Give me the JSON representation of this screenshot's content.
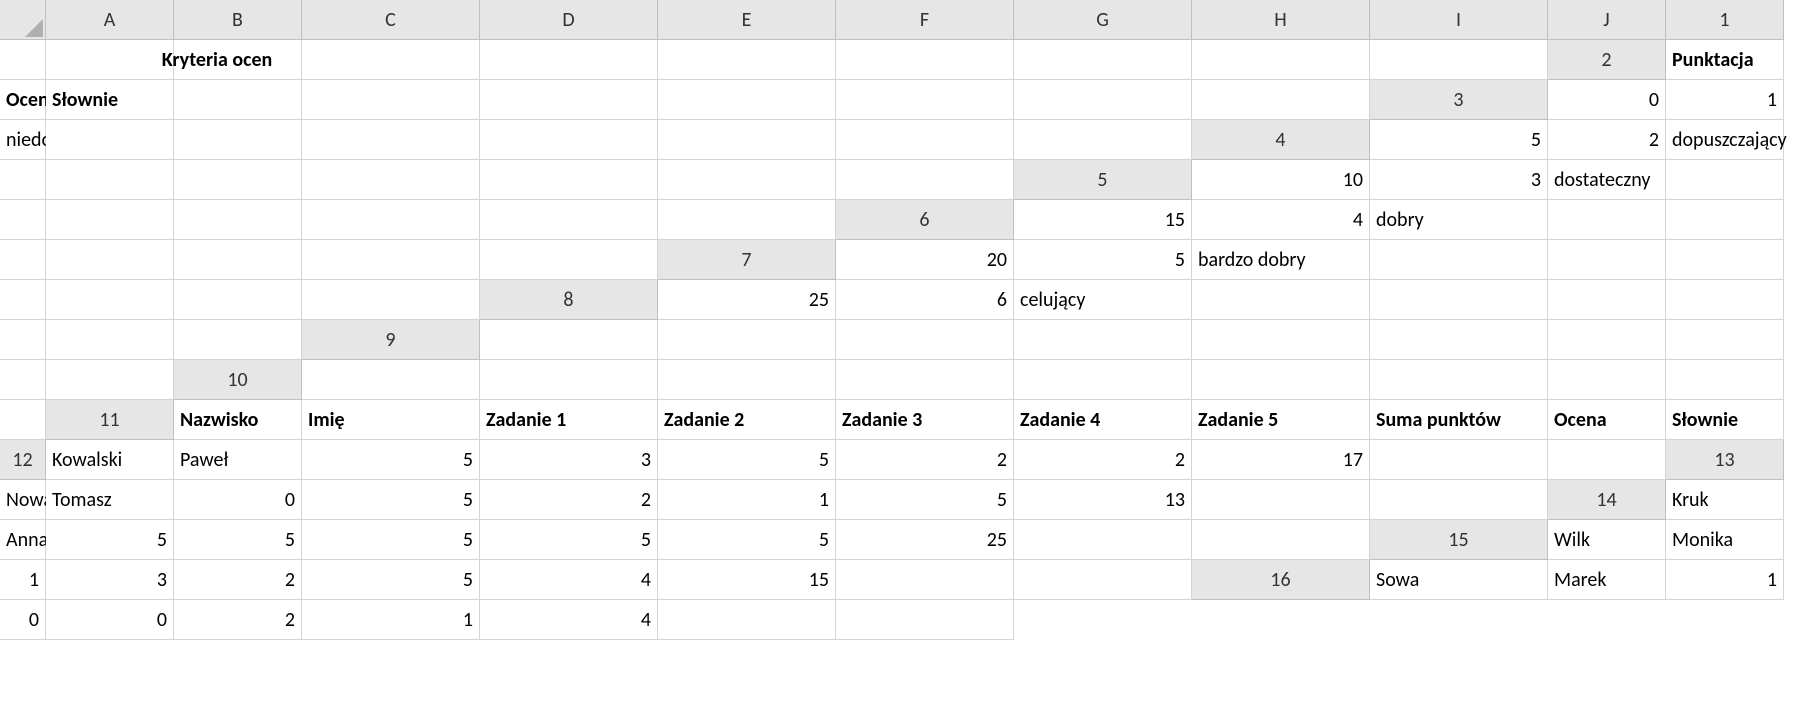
{
  "columns": [
    "A",
    "B",
    "C",
    "D",
    "E",
    "F",
    "G",
    "H",
    "I",
    "J"
  ],
  "rowCount": 16,
  "cells": {
    "r1": {
      "A": {
        "v": "Kryteria ocen",
        "bold": true,
        "center": true,
        "span": true
      }
    },
    "r2": {
      "A": {
        "v": "Punktacja",
        "bold": true
      },
      "B": {
        "v": "Ocena",
        "bold": true
      },
      "C": {
        "v": "Słownie",
        "bold": true
      }
    },
    "r3": {
      "A": {
        "v": "0",
        "num": true
      },
      "B": {
        "v": "1",
        "num": true
      },
      "C": {
        "v": "niedostateczny"
      }
    },
    "r4": {
      "A": {
        "v": "5",
        "num": true
      },
      "B": {
        "v": "2",
        "num": true
      },
      "C": {
        "v": "dopuszczający"
      }
    },
    "r5": {
      "A": {
        "v": "10",
        "num": true
      },
      "B": {
        "v": "3",
        "num": true
      },
      "C": {
        "v": "dostateczny"
      }
    },
    "r6": {
      "A": {
        "v": "15",
        "num": true
      },
      "B": {
        "v": "4",
        "num": true
      },
      "C": {
        "v": "dobry"
      }
    },
    "r7": {
      "A": {
        "v": "20",
        "num": true
      },
      "B": {
        "v": "5",
        "num": true
      },
      "C": {
        "v": "bardzo dobry"
      }
    },
    "r8": {
      "A": {
        "v": "25",
        "num": true
      },
      "B": {
        "v": "6",
        "num": true
      },
      "C": {
        "v": "celujący"
      }
    },
    "r9": {},
    "r10": {},
    "r11": {
      "A": {
        "v": "Nazwisko",
        "bold": true
      },
      "B": {
        "v": "Imię",
        "bold": true
      },
      "C": {
        "v": "Zadanie 1",
        "bold": true
      },
      "D": {
        "v": "Zadanie 2",
        "bold": true
      },
      "E": {
        "v": "Zadanie 3",
        "bold": true
      },
      "F": {
        "v": "Zadanie 4",
        "bold": true
      },
      "G": {
        "v": "Zadanie 5",
        "bold": true
      },
      "H": {
        "v": "Suma punktów",
        "bold": true
      },
      "I": {
        "v": "Ocena",
        "bold": true
      },
      "J": {
        "v": "Słownie",
        "bold": true
      }
    },
    "r12": {
      "A": {
        "v": "Kowalski"
      },
      "B": {
        "v": "Paweł"
      },
      "C": {
        "v": "5",
        "num": true
      },
      "D": {
        "v": "3",
        "num": true
      },
      "E": {
        "v": "5",
        "num": true
      },
      "F": {
        "v": "2",
        "num": true
      },
      "G": {
        "v": "2",
        "num": true
      },
      "H": {
        "v": "17",
        "num": true
      }
    },
    "r13": {
      "A": {
        "v": "Nowak"
      },
      "B": {
        "v": "Tomasz"
      },
      "C": {
        "v": "0",
        "num": true
      },
      "D": {
        "v": "5",
        "num": true
      },
      "E": {
        "v": "2",
        "num": true
      },
      "F": {
        "v": "1",
        "num": true
      },
      "G": {
        "v": "5",
        "num": true
      },
      "H": {
        "v": "13",
        "num": true
      }
    },
    "r14": {
      "A": {
        "v": "Kruk"
      },
      "B": {
        "v": "Anna"
      },
      "C": {
        "v": "5",
        "num": true
      },
      "D": {
        "v": "5",
        "num": true
      },
      "E": {
        "v": "5",
        "num": true
      },
      "F": {
        "v": "5",
        "num": true
      },
      "G": {
        "v": "5",
        "num": true
      },
      "H": {
        "v": "25",
        "num": true
      }
    },
    "r15": {
      "A": {
        "v": "Wilk"
      },
      "B": {
        "v": "Monika"
      },
      "C": {
        "v": "1",
        "num": true
      },
      "D": {
        "v": "3",
        "num": true
      },
      "E": {
        "v": "2",
        "num": true
      },
      "F": {
        "v": "5",
        "num": true
      },
      "G": {
        "v": "4",
        "num": true
      },
      "H": {
        "v": "15",
        "num": true
      }
    },
    "r16": {
      "A": {
        "v": "Sowa"
      },
      "B": {
        "v": "Marek"
      },
      "C": {
        "v": "1",
        "num": true
      },
      "D": {
        "v": "0",
        "num": true
      },
      "E": {
        "v": "0",
        "num": true
      },
      "F": {
        "v": "2",
        "num": true
      },
      "G": {
        "v": "1",
        "num": true
      },
      "H": {
        "v": "4",
        "num": true
      }
    }
  }
}
